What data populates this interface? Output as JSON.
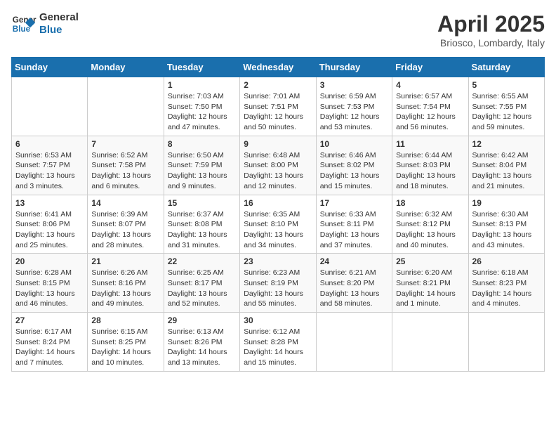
{
  "header": {
    "logo_line1": "General",
    "logo_line2": "Blue",
    "month_title": "April 2025",
    "subtitle": "Briosco, Lombardy, Italy"
  },
  "weekdays": [
    "Sunday",
    "Monday",
    "Tuesday",
    "Wednesday",
    "Thursday",
    "Friday",
    "Saturday"
  ],
  "weeks": [
    [
      {
        "day": "",
        "info": ""
      },
      {
        "day": "",
        "info": ""
      },
      {
        "day": "1",
        "info": "Sunrise: 7:03 AM\nSunset: 7:50 PM\nDaylight: 12 hours and 47 minutes."
      },
      {
        "day": "2",
        "info": "Sunrise: 7:01 AM\nSunset: 7:51 PM\nDaylight: 12 hours and 50 minutes."
      },
      {
        "day": "3",
        "info": "Sunrise: 6:59 AM\nSunset: 7:53 PM\nDaylight: 12 hours and 53 minutes."
      },
      {
        "day": "4",
        "info": "Sunrise: 6:57 AM\nSunset: 7:54 PM\nDaylight: 12 hours and 56 minutes."
      },
      {
        "day": "5",
        "info": "Sunrise: 6:55 AM\nSunset: 7:55 PM\nDaylight: 12 hours and 59 minutes."
      }
    ],
    [
      {
        "day": "6",
        "info": "Sunrise: 6:53 AM\nSunset: 7:57 PM\nDaylight: 13 hours and 3 minutes."
      },
      {
        "day": "7",
        "info": "Sunrise: 6:52 AM\nSunset: 7:58 PM\nDaylight: 13 hours and 6 minutes."
      },
      {
        "day": "8",
        "info": "Sunrise: 6:50 AM\nSunset: 7:59 PM\nDaylight: 13 hours and 9 minutes."
      },
      {
        "day": "9",
        "info": "Sunrise: 6:48 AM\nSunset: 8:00 PM\nDaylight: 13 hours and 12 minutes."
      },
      {
        "day": "10",
        "info": "Sunrise: 6:46 AM\nSunset: 8:02 PM\nDaylight: 13 hours and 15 minutes."
      },
      {
        "day": "11",
        "info": "Sunrise: 6:44 AM\nSunset: 8:03 PM\nDaylight: 13 hours and 18 minutes."
      },
      {
        "day": "12",
        "info": "Sunrise: 6:42 AM\nSunset: 8:04 PM\nDaylight: 13 hours and 21 minutes."
      }
    ],
    [
      {
        "day": "13",
        "info": "Sunrise: 6:41 AM\nSunset: 8:06 PM\nDaylight: 13 hours and 25 minutes."
      },
      {
        "day": "14",
        "info": "Sunrise: 6:39 AM\nSunset: 8:07 PM\nDaylight: 13 hours and 28 minutes."
      },
      {
        "day": "15",
        "info": "Sunrise: 6:37 AM\nSunset: 8:08 PM\nDaylight: 13 hours and 31 minutes."
      },
      {
        "day": "16",
        "info": "Sunrise: 6:35 AM\nSunset: 8:10 PM\nDaylight: 13 hours and 34 minutes."
      },
      {
        "day": "17",
        "info": "Sunrise: 6:33 AM\nSunset: 8:11 PM\nDaylight: 13 hours and 37 minutes."
      },
      {
        "day": "18",
        "info": "Sunrise: 6:32 AM\nSunset: 8:12 PM\nDaylight: 13 hours and 40 minutes."
      },
      {
        "day": "19",
        "info": "Sunrise: 6:30 AM\nSunset: 8:13 PM\nDaylight: 13 hours and 43 minutes."
      }
    ],
    [
      {
        "day": "20",
        "info": "Sunrise: 6:28 AM\nSunset: 8:15 PM\nDaylight: 13 hours and 46 minutes."
      },
      {
        "day": "21",
        "info": "Sunrise: 6:26 AM\nSunset: 8:16 PM\nDaylight: 13 hours and 49 minutes."
      },
      {
        "day": "22",
        "info": "Sunrise: 6:25 AM\nSunset: 8:17 PM\nDaylight: 13 hours and 52 minutes."
      },
      {
        "day": "23",
        "info": "Sunrise: 6:23 AM\nSunset: 8:19 PM\nDaylight: 13 hours and 55 minutes."
      },
      {
        "day": "24",
        "info": "Sunrise: 6:21 AM\nSunset: 8:20 PM\nDaylight: 13 hours and 58 minutes."
      },
      {
        "day": "25",
        "info": "Sunrise: 6:20 AM\nSunset: 8:21 PM\nDaylight: 14 hours and 1 minute."
      },
      {
        "day": "26",
        "info": "Sunrise: 6:18 AM\nSunset: 8:23 PM\nDaylight: 14 hours and 4 minutes."
      }
    ],
    [
      {
        "day": "27",
        "info": "Sunrise: 6:17 AM\nSunset: 8:24 PM\nDaylight: 14 hours and 7 minutes."
      },
      {
        "day": "28",
        "info": "Sunrise: 6:15 AM\nSunset: 8:25 PM\nDaylight: 14 hours and 10 minutes."
      },
      {
        "day": "29",
        "info": "Sunrise: 6:13 AM\nSunset: 8:26 PM\nDaylight: 14 hours and 13 minutes."
      },
      {
        "day": "30",
        "info": "Sunrise: 6:12 AM\nSunset: 8:28 PM\nDaylight: 14 hours and 15 minutes."
      },
      {
        "day": "",
        "info": ""
      },
      {
        "day": "",
        "info": ""
      },
      {
        "day": "",
        "info": ""
      }
    ]
  ]
}
